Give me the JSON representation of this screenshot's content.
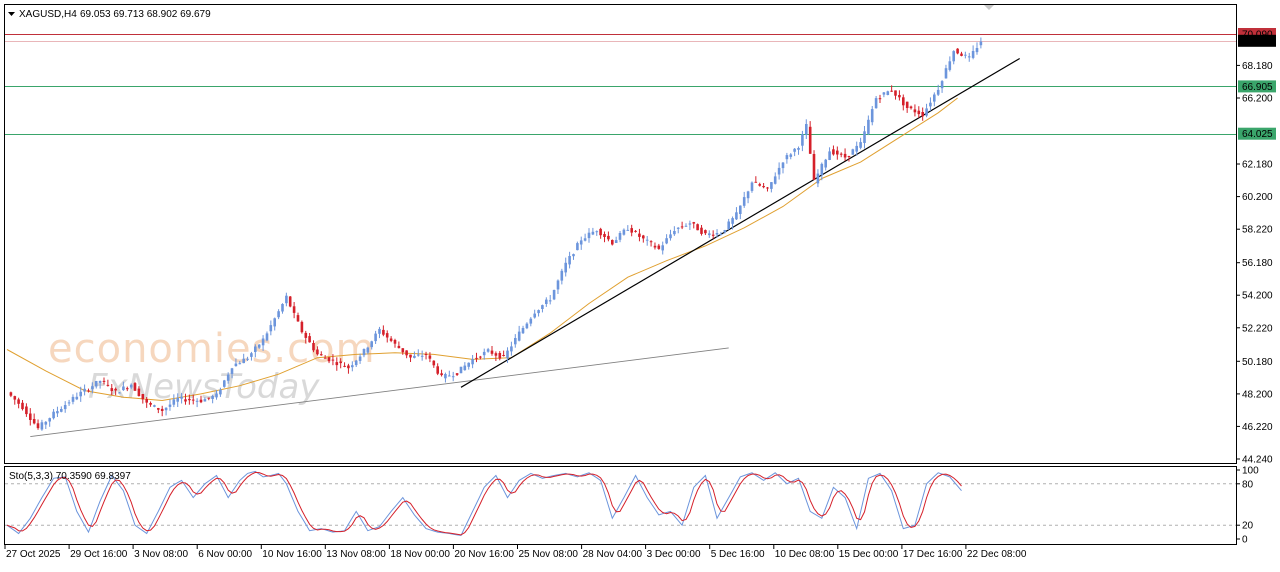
{
  "header": {
    "symbol": "XAGUSD,H4",
    "ohlc": "69.053 69.713 68.902 69.679"
  },
  "watermark": {
    "line1": "economies.com",
    "line2": "FxNewsToday"
  },
  "colors": {
    "bull": "#6c95dc",
    "bear": "#d5202a",
    "ma": "#e0a030",
    "support": "#3aa56b",
    "resistance": "#c0303a",
    "trend": "#000000",
    "stoch_main": "#6c95dc",
    "stoch_signal": "#d5202a"
  },
  "chart_data": [
    {
      "type": "candlestick",
      "title": "XAGUSD,H4",
      "ylim": [
        44.24,
        71.2
      ],
      "y_ticks": [
        "70.090",
        "69.679",
        "68.180",
        "66.905",
        "66.200",
        "64.025",
        "62.180",
        "60.200",
        "58.220",
        "56.180",
        "54.200",
        "52.220",
        "50.180",
        "48.200",
        "46.220",
        "44.240"
      ],
      "x_ticks": [
        "27 Oct 2025",
        "29 Oct 16:00",
        "3 Nov 08:00",
        "6 Nov 00:00",
        "10 Nov 16:00",
        "13 Nov 08:00",
        "18 Nov 00:00",
        "20 Nov 16:00",
        "25 Nov 08:00",
        "28 Nov 04:00",
        "3 Dec 00:00",
        "5 Dec 16:00",
        "10 Dec 08:00",
        "15 Dec 00:00",
        "17 Dec 16:00",
        "22 Dec 08:00"
      ],
      "price_path": [
        [
          0,
          48.3
        ],
        [
          4,
          47.4
        ],
        [
          8,
          46.1
        ],
        [
          12,
          47.0
        ],
        [
          18,
          48.1
        ],
        [
          24,
          49.0
        ],
        [
          28,
          48.3
        ],
        [
          32,
          48.8
        ],
        [
          36,
          47.6
        ],
        [
          40,
          47.2
        ],
        [
          44,
          47.9
        ],
        [
          50,
          47.8
        ],
        [
          54,
          48.1
        ],
        [
          58,
          49.9
        ],
        [
          62,
          50.4
        ],
        [
          66,
          51.5
        ],
        [
          70,
          53.2
        ],
        [
          72,
          54.1
        ],
        [
          74,
          53.0
        ],
        [
          76,
          52.0
        ],
        [
          80,
          50.6
        ],
        [
          84,
          50.2
        ],
        [
          88,
          49.8
        ],
        [
          92,
          50.8
        ],
        [
          96,
          52.1
        ],
        [
          100,
          51.2
        ],
        [
          104,
          50.4
        ],
        [
          108,
          50.6
        ],
        [
          112,
          49.2
        ],
        [
          116,
          49.5
        ],
        [
          120,
          50.3
        ],
        [
          124,
          50.8
        ],
        [
          128,
          50.4
        ],
        [
          132,
          51.9
        ],
        [
          136,
          53.2
        ],
        [
          140,
          54.0
        ],
        [
          144,
          56.1
        ],
        [
          148,
          57.6
        ],
        [
          152,
          58.2
        ],
        [
          156,
          57.4
        ],
        [
          160,
          58.3
        ],
        [
          164,
          57.6
        ],
        [
          168,
          57.0
        ],
        [
          172,
          58.2
        ],
        [
          176,
          58.6
        ],
        [
          180,
          57.9
        ],
        [
          184,
          58.0
        ],
        [
          188,
          59.1
        ],
        [
          192,
          61.1
        ],
        [
          196,
          60.6
        ],
        [
          200,
          62.4
        ],
        [
          204,
          63.3
        ],
        [
          206,
          64.5
        ],
        [
          208,
          61.1
        ],
        [
          212,
          63.0
        ],
        [
          216,
          62.6
        ],
        [
          220,
          63.4
        ],
        [
          224,
          66.2
        ],
        [
          228,
          66.7
        ],
        [
          232,
          65.6
        ],
        [
          236,
          65.2
        ],
        [
          240,
          66.8
        ],
        [
          244,
          69.1
        ],
        [
          248,
          68.6
        ],
        [
          251,
          69.68
        ]
      ],
      "last_price": 69.679,
      "moving_average": [
        [
          0,
          50.9
        ],
        [
          10,
          49.6
        ],
        [
          20,
          48.4
        ],
        [
          30,
          48.0
        ],
        [
          40,
          47.8
        ],
        [
          50,
          48.2
        ],
        [
          60,
          48.7
        ],
        [
          70,
          49.4
        ],
        [
          80,
          50.4
        ],
        [
          90,
          50.6
        ],
        [
          100,
          50.7
        ],
        [
          110,
          50.6
        ],
        [
          120,
          50.3
        ],
        [
          130,
          50.4
        ],
        [
          140,
          51.9
        ],
        [
          150,
          53.7
        ],
        [
          160,
          55.3
        ],
        [
          170,
          56.3
        ],
        [
          180,
          57.2
        ],
        [
          190,
          58.3
        ],
        [
          200,
          59.6
        ],
        [
          210,
          61.3
        ],
        [
          220,
          62.3
        ],
        [
          230,
          63.8
        ],
        [
          240,
          65.3
        ],
        [
          245,
          66.2
        ]
      ],
      "horizontal_levels": [
        {
          "label": "70.090",
          "value": 70.09,
          "color": "#c0303a"
        },
        {
          "label": "66.905",
          "value": 66.905,
          "color": "#3aa56b"
        },
        {
          "label": "64.025",
          "value": 64.025,
          "color": "#3aa56b"
        }
      ],
      "trend_lines": [
        {
          "from": [
            6,
            45.6
          ],
          "to": [
            186,
            51.0
          ],
          "color": "#808080"
        },
        {
          "from": [
            117,
            48.6
          ],
          "to": [
            261,
            68.6
          ],
          "color": "#000000"
        }
      ]
    },
    {
      "type": "line",
      "title": "Sto(5,3,3) 70.3590 69.8397",
      "ylim": [
        0,
        100
      ],
      "y_ticks": [
        "100",
        "80",
        "20",
        "0"
      ],
      "levels": [
        80,
        20
      ],
      "main_path": [
        [
          0,
          20
        ],
        [
          3,
          8
        ],
        [
          6,
          30
        ],
        [
          9,
          60
        ],
        [
          12,
          88
        ],
        [
          15,
          90
        ],
        [
          18,
          40
        ],
        [
          21,
          10
        ],
        [
          24,
          55
        ],
        [
          27,
          92
        ],
        [
          30,
          70
        ],
        [
          33,
          20
        ],
        [
          36,
          8
        ],
        [
          39,
          40
        ],
        [
          42,
          75
        ],
        [
          45,
          85
        ],
        [
          48,
          60
        ],
        [
          51,
          80
        ],
        [
          54,
          92
        ],
        [
          57,
          60
        ],
        [
          60,
          85
        ],
        [
          62,
          95
        ],
        [
          64,
          98
        ],
        [
          66,
          90
        ],
        [
          68,
          92
        ],
        [
          70,
          95
        ],
        [
          72,
          80
        ],
        [
          75,
          40
        ],
        [
          78,
          12
        ],
        [
          81,
          15
        ],
        [
          84,
          10
        ],
        [
          87,
          12
        ],
        [
          90,
          40
        ],
        [
          93,
          12
        ],
        [
          96,
          18
        ],
        [
          99,
          40
        ],
        [
          102,
          60
        ],
        [
          105,
          35
        ],
        [
          108,
          15
        ],
        [
          111,
          10
        ],
        [
          114,
          8
        ],
        [
          117,
          5
        ],
        [
          120,
          40
        ],
        [
          123,
          75
        ],
        [
          126,
          92
        ],
        [
          129,
          60
        ],
        [
          132,
          85
        ],
        [
          135,
          95
        ],
        [
          138,
          88
        ],
        [
          141,
          92
        ],
        [
          144,
          95
        ],
        [
          147,
          90
        ],
        [
          150,
          96
        ],
        [
          153,
          85
        ],
        [
          156,
          30
        ],
        [
          159,
          60
        ],
        [
          162,
          92
        ],
        [
          165,
          60
        ],
        [
          168,
          35
        ],
        [
          171,
          40
        ],
        [
          174,
          20
        ],
        [
          177,
          75
        ],
        [
          180,
          92
        ],
        [
          183,
          30
        ],
        [
          186,
          60
        ],
        [
          189,
          90
        ],
        [
          192,
          96
        ],
        [
          195,
          85
        ],
        [
          198,
          96
        ],
        [
          201,
          80
        ],
        [
          204,
          88
        ],
        [
          207,
          40
        ],
        [
          210,
          30
        ],
        [
          213,
          75
        ],
        [
          216,
          60
        ],
        [
          219,
          15
        ],
        [
          222,
          88
        ],
        [
          225,
          95
        ],
        [
          228,
          70
        ],
        [
          231,
          15
        ],
        [
          234,
          20
        ],
        [
          237,
          80
        ],
        [
          240,
          96
        ],
        [
          243,
          90
        ],
        [
          246,
          70
        ]
      ],
      "last_main": 70.359,
      "last_signal": 69.8397
    }
  ]
}
